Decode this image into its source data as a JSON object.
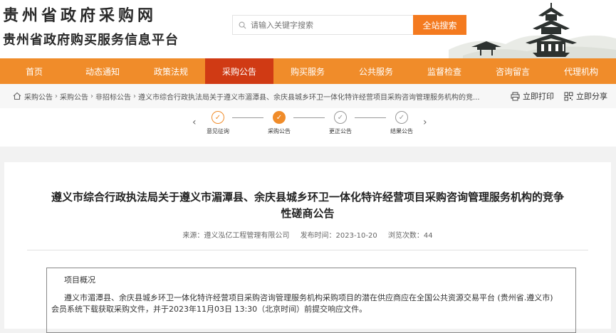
{
  "header": {
    "logo_line1": "贵州省政府采购网",
    "logo_line2": "贵州省政府购买服务信息平台",
    "search_placeholder": "请输入关键字搜索",
    "search_button": "全站搜索"
  },
  "nav": {
    "items": [
      "首页",
      "动态通知",
      "政策法规",
      "采购公告",
      "购买服务",
      "公共服务",
      "监督检查",
      "咨询留言",
      "代理机构"
    ],
    "active_index": 3
  },
  "breadcrumb": {
    "items": [
      "采购公告",
      "采购公告",
      "非招标公告",
      "遵义市综合行政执法局关于遵义市湄潭县、余庆县城乡环卫一体化特许经营项目采购咨询管理服务机构的竞..."
    ],
    "print_label": "立即打印",
    "share_label": "立即分享"
  },
  "steps": {
    "items": [
      {
        "label": "意见征询",
        "state": "done"
      },
      {
        "label": "采购公告",
        "state": "current"
      },
      {
        "label": "更正公告",
        "state": "pending"
      },
      {
        "label": "结果公告",
        "state": "pending"
      }
    ]
  },
  "article": {
    "title": "遵义市综合行政执法局关于遵义市湄潭县、余庆县城乡环卫一体化特许经营项目采购咨询管理服务机构的竞争性磋商公告",
    "source": "来源：遵义泓亿工程管理有限公司",
    "date": "发布时间：2023-10-20",
    "views": "浏览次数：44",
    "section_title": "项目概况",
    "section_body": "遵义市湄潭县、余庆县城乡环卫一体化特许经营项目采购咨询管理服务机构采购项目的潜在供应商应在全国公共资源交易平台 (贵州省.遵义市) 会员系统下载获取采购文件，并于2023年11月03日 13:30（北京时间）前提交响应文件。"
  },
  "colors": {
    "nav": "#f08c2a",
    "nav_active": "#d03a14",
    "accent": "#f47a1f"
  }
}
